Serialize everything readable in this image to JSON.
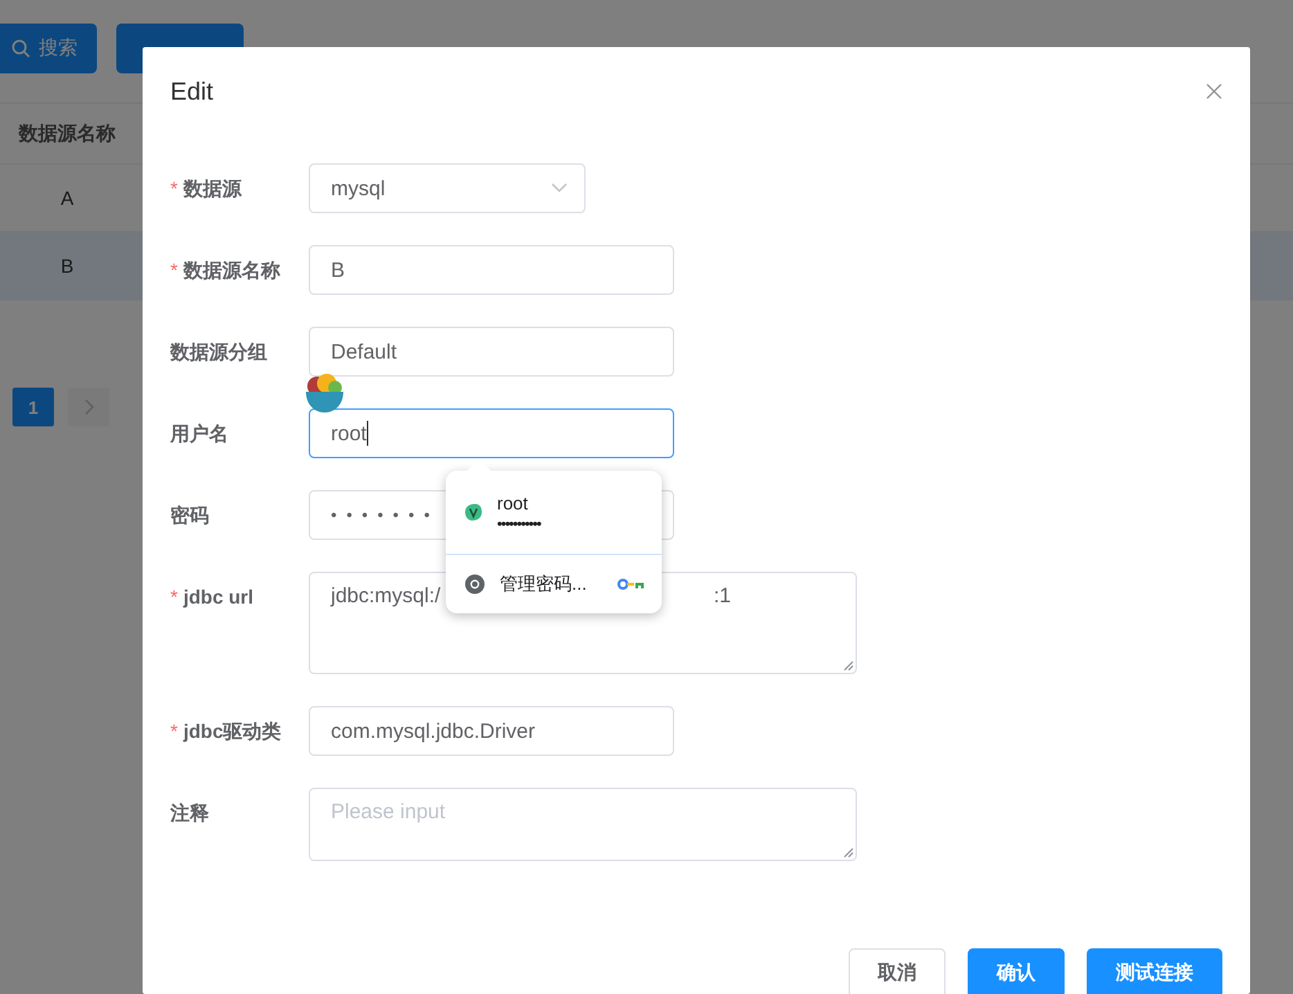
{
  "background": {
    "buttons": [
      {
        "kind": "search",
        "label": "搜索"
      },
      {
        "kind": "add"
      }
    ],
    "table": {
      "columns": [
        "数据源名称"
      ],
      "rows": [
        {
          "cells": [
            "A"
          ],
          "selected": false
        },
        {
          "cells": [
            "B"
          ],
          "selected": true
        }
      ]
    },
    "pagination": {
      "pages": [
        {
          "label": "1",
          "selected": true
        }
      ]
    }
  },
  "dialog": {
    "title": "Edit",
    "required_mark": "*",
    "fields": [
      {
        "label": "数据源",
        "required": true,
        "kind": "select",
        "value": "mysql",
        "focused": false
      },
      {
        "label": "数据源名称",
        "required": true,
        "kind": "input",
        "value": "B",
        "focused": false
      },
      {
        "label": "数据源分组",
        "required": false,
        "kind": "input",
        "value": "Default",
        "focused": false
      },
      {
        "label": "用户名",
        "required": false,
        "kind": "input",
        "value": "root",
        "focused": true
      },
      {
        "label": "密码",
        "required": false,
        "kind": "password",
        "value": "•••••••",
        "focused": false
      },
      {
        "label": "jdbc url",
        "required": true,
        "kind": "textarea",
        "value": "jdbc:mysql:/",
        "value_end": ":1",
        "focused": false
      },
      {
        "label": "jdbc驱动类",
        "required": true,
        "kind": "input",
        "value": "com.mysql.jdbc.Driver",
        "focused": false
      },
      {
        "label": "注释",
        "required": false,
        "kind": "textarea",
        "placeholder": "Please input",
        "focused": false
      }
    ],
    "buttons": [
      {
        "label": "取消",
        "primary": false
      },
      {
        "label": "确认",
        "primary": true
      },
      {
        "label": "测试连接",
        "primary": true
      }
    ]
  },
  "autofill": {
    "entries": [
      {
        "username": "root",
        "password": "•••••••••••"
      }
    ],
    "manage": "管理密码..."
  }
}
